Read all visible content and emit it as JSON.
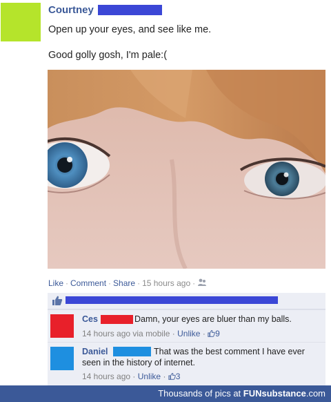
{
  "post": {
    "author": "Courtney",
    "line1": "Open up your eyes, and see like me.",
    "line2": "Good golly gosh, I'm pale:("
  },
  "actions": {
    "like": "Like",
    "comment": "Comment",
    "share": "Share",
    "time": "15 hours ago",
    "sep": "·"
  },
  "comments": [
    {
      "name": "Ces",
      "text": "Damn, your eyes are bluer than my balls.",
      "time": "14 hours ago via mobile",
      "unlike": "Unlike",
      "likes": "9",
      "avatar_color": "#e8202a"
    },
    {
      "name": "Daniel",
      "text": "That was the best comment I have ever seen in the history of internet.",
      "time": "14 hours ago",
      "unlike": "Unlike",
      "likes": "3",
      "avatar_color": "#1e8fe0"
    }
  ],
  "footer": {
    "prefix": "Thousands of pics at",
    "brand": "FUNsubstance",
    "suffix": ".com"
  },
  "colors": {
    "link": "#3b5998",
    "redaction_blue": "#3b47d6",
    "redaction_red": "#e8202a",
    "avatar_green": "#b5e42b"
  },
  "icons": [
    "thumbs-up-icon",
    "people-icon",
    "like-icon"
  ]
}
